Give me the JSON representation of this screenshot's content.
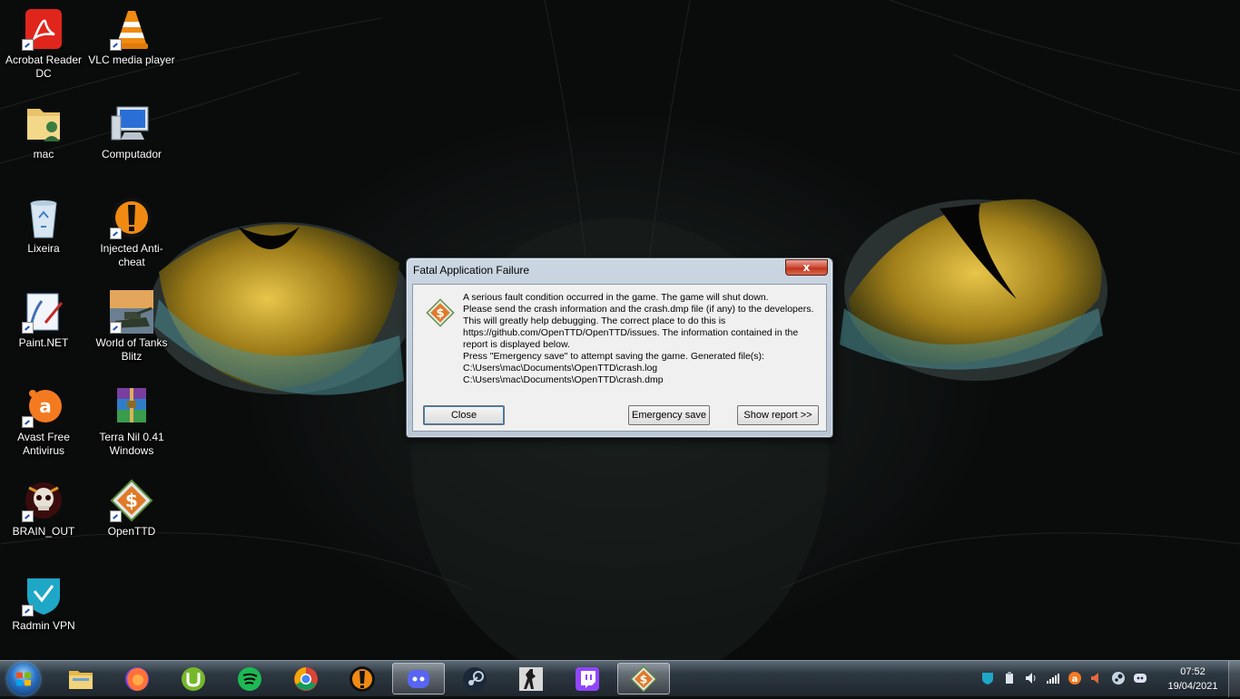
{
  "desktop": {
    "icons": [
      {
        "label": "Acrobat Reader DC",
        "icon": "acrobat-icon"
      },
      {
        "label": "VLC media player",
        "icon": "vlc-icon"
      },
      {
        "label": "mac",
        "icon": "user-folder-icon"
      },
      {
        "label": "Computador",
        "icon": "computer-icon"
      },
      {
        "label": "Lixeira",
        "icon": "recycle-bin-icon"
      },
      {
        "label": "Injected Anti-cheat",
        "icon": "injected-icon"
      },
      {
        "label": "Paint.NET",
        "icon": "paintnet-icon"
      },
      {
        "label": "World of Tanks Blitz",
        "icon": "wot-blitz-icon"
      },
      {
        "label": "Avast Free Antivirus",
        "icon": "avast-icon"
      },
      {
        "label": "Terra Nil 0.41 Windows",
        "icon": "winrar-icon"
      },
      {
        "label": "BRAIN_OUT",
        "icon": "brain-out-icon"
      },
      {
        "label": "OpenTTD",
        "icon": "openttd-icon"
      },
      {
        "label": "Radmin VPN",
        "icon": "radmin-icon"
      }
    ]
  },
  "dialog": {
    "title": "Fatal Application Failure",
    "close_glyph": "x",
    "message": "A serious fault condition occurred in the game. The game will shut down.\nPlease send the crash information and the crash.dmp file (if any) to the developers.\nThis will greatly help debugging. The correct place to do this is\nhttps://github.com/OpenTTD/OpenTTD/issues. The information contained in the\nreport is displayed below.\nPress \"Emergency save\" to attempt saving the game. Generated file(s):\nC:\\Users\\mac\\Documents\\OpenTTD\\crash.log\nC:\\Users\\mac\\Documents\\OpenTTD\\crash.dmp",
    "buttons": {
      "close": "Close",
      "emergency_save": "Emergency save",
      "show_report": "Show report >>"
    }
  },
  "taskbar": {
    "pinned": [
      {
        "name": "file-explorer",
        "icon": "folder-icon",
        "active": false
      },
      {
        "name": "firefox",
        "icon": "firefox-icon",
        "active": false
      },
      {
        "name": "utorrent",
        "icon": "utorrent-icon",
        "active": false
      },
      {
        "name": "spotify",
        "icon": "spotify-icon",
        "active": false
      },
      {
        "name": "chrome",
        "icon": "chrome-icon",
        "active": false
      },
      {
        "name": "injected",
        "icon": "injected-icon",
        "active": false
      },
      {
        "name": "discord",
        "icon": "discord-icon",
        "active": true
      },
      {
        "name": "steam",
        "icon": "steam-icon",
        "active": false
      },
      {
        "name": "counter-strike",
        "icon": "cs-icon",
        "active": false
      },
      {
        "name": "twitch",
        "icon": "twitch-icon",
        "active": false
      },
      {
        "name": "openttd",
        "icon": "openttd-icon",
        "active": true
      }
    ],
    "clock": {
      "time": "07:52",
      "date": "19/04/2021"
    }
  },
  "colors": {
    "accent_eye": "#c9a524",
    "taskbar": "#26313a",
    "dialog_frame": "#c3cfdc",
    "close_red": "#c8432b"
  }
}
